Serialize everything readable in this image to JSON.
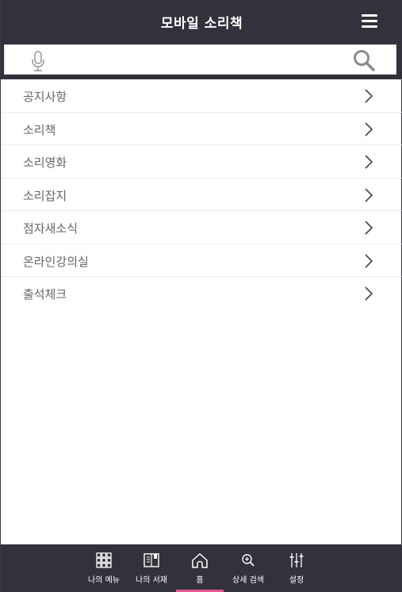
{
  "header": {
    "title": "모바일 소리책",
    "menu_icon": "hamburger-menu-icon"
  },
  "search": {
    "value": "",
    "placeholder": "",
    "mic_icon": "microphone-icon",
    "search_icon": "magnifier-icon"
  },
  "menu": {
    "items": [
      {
        "label": "공지사항"
      },
      {
        "label": "소리책"
      },
      {
        "label": "소리영화"
      },
      {
        "label": "소리잡지"
      },
      {
        "label": "점자새소식"
      },
      {
        "label": "온라인강의실"
      },
      {
        "label": "출석체크"
      }
    ]
  },
  "bottom_nav": {
    "items": [
      {
        "label": "나의 메뉴",
        "icon": "grid-icon"
      },
      {
        "label": "나의 서재",
        "icon": "book-icon"
      },
      {
        "label": "홈",
        "icon": "home-icon",
        "active": true
      },
      {
        "label": "상세 검색",
        "icon": "zoom-search-icon"
      },
      {
        "label": "설정",
        "icon": "sliders-icon"
      }
    ],
    "active_color": "#e8568f"
  },
  "colors": {
    "header_bg": "#32323c",
    "text_muted": "#666666"
  }
}
